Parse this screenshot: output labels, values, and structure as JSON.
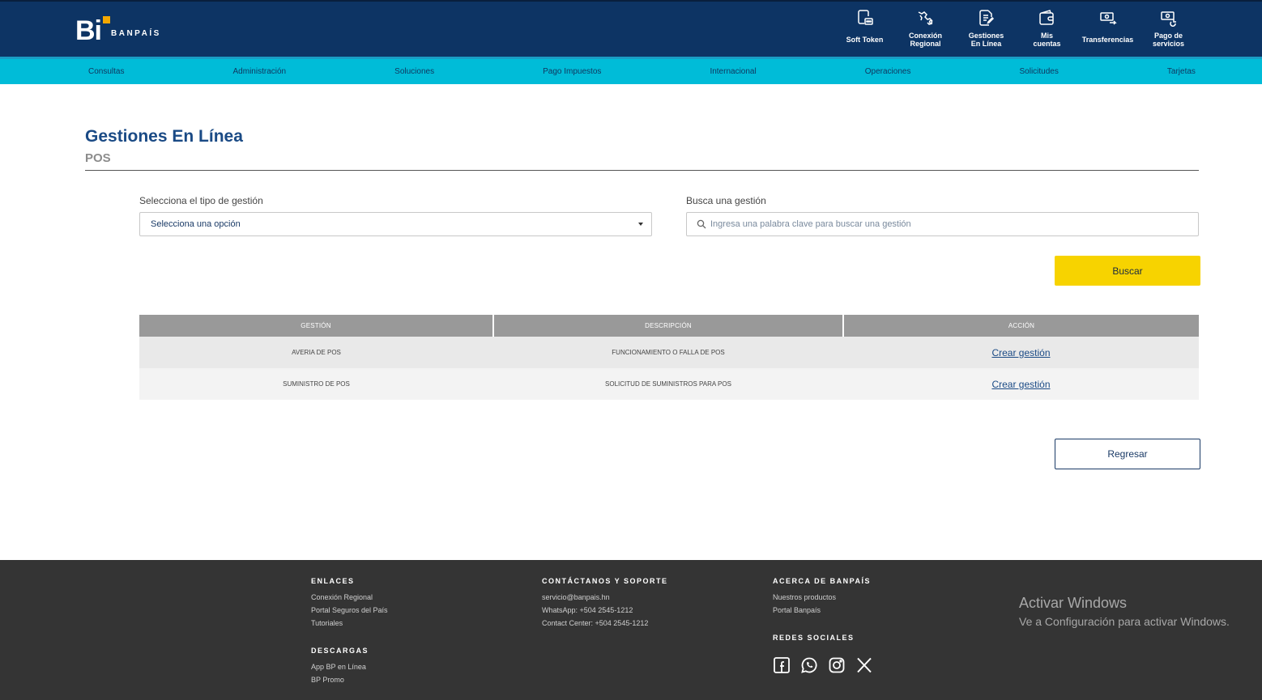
{
  "brand": {
    "logo_mark": "Bi",
    "logo_text": "BANPAÍS",
    "accent_color": "#f5a800",
    "header_color": "#0d3464",
    "nav_color": "#00bcd8"
  },
  "quick_links": [
    {
      "label": "Soft Token",
      "icon": "soft-token-icon"
    },
    {
      "label": "Conexión\nRegional",
      "icon": "regional-connection-icon"
    },
    {
      "label": "Gestiones\nEn Línea",
      "icon": "document-edit-icon"
    },
    {
      "label": "Mis\ncuentas",
      "icon": "wallet-icon"
    },
    {
      "label": "Transferencias",
      "icon": "transfer-icon"
    },
    {
      "label": "Pago de\nservicios",
      "icon": "service-payment-icon"
    }
  ],
  "nav": [
    "Consultas",
    "Administración",
    "Soluciones",
    "Pago Impuestos",
    "Internacional",
    "Operaciones",
    "Solicitudes",
    "Tarjetas"
  ],
  "page": {
    "title": "Gestiones En Línea",
    "subtitle": "POS"
  },
  "form": {
    "type_label": "Selecciona el tipo de gestión",
    "type_value": "Selecciona una opción",
    "search_label": "Busca una gestión",
    "search_placeholder": "Ingresa una palabra clave para buscar una gestión",
    "search_button": "Buscar",
    "search_button_color": "#f7d300"
  },
  "table": {
    "headers": [
      "Gestión",
      "Descripción",
      "Acción"
    ],
    "rows": [
      {
        "gestion": "Averia de POS",
        "descripcion": "Funcionamiento o falla de POS",
        "accion": "Crear gestión"
      },
      {
        "gestion": "Suministro de POS",
        "descripcion": "Solicitud de suministros para POS",
        "accion": "Crear gestión"
      }
    ]
  },
  "back_button": "Regresar",
  "footer": {
    "enlaces": {
      "heading": "ENLACES",
      "items": [
        "Conexión Regional",
        "Portal Seguros del País",
        "Tutoriales"
      ]
    },
    "descargas": {
      "heading": "DESCARGAS",
      "items": [
        "App BP en Línea",
        "BP Promo"
      ]
    },
    "contacto": {
      "heading": "CONTÁCTANOS Y SOPORTE",
      "items": [
        "servicio@banpais.hn",
        "WhatsApp: +504 2545-1212",
        "Contact Center: +504 2545-1212"
      ]
    },
    "acerca": {
      "heading": "ACERCA DE BANPAÍS",
      "items": [
        "Nuestros productos",
        "Portal Banpaís"
      ]
    },
    "redes": {
      "heading": "REDES SOCIALES",
      "icons": [
        "facebook-icon",
        "whatsapp-icon",
        "instagram-icon",
        "x-icon"
      ]
    }
  },
  "windows_overlay": {
    "title": "Activar Windows",
    "subtitle": "Ve a Configuración para activar Windows."
  }
}
